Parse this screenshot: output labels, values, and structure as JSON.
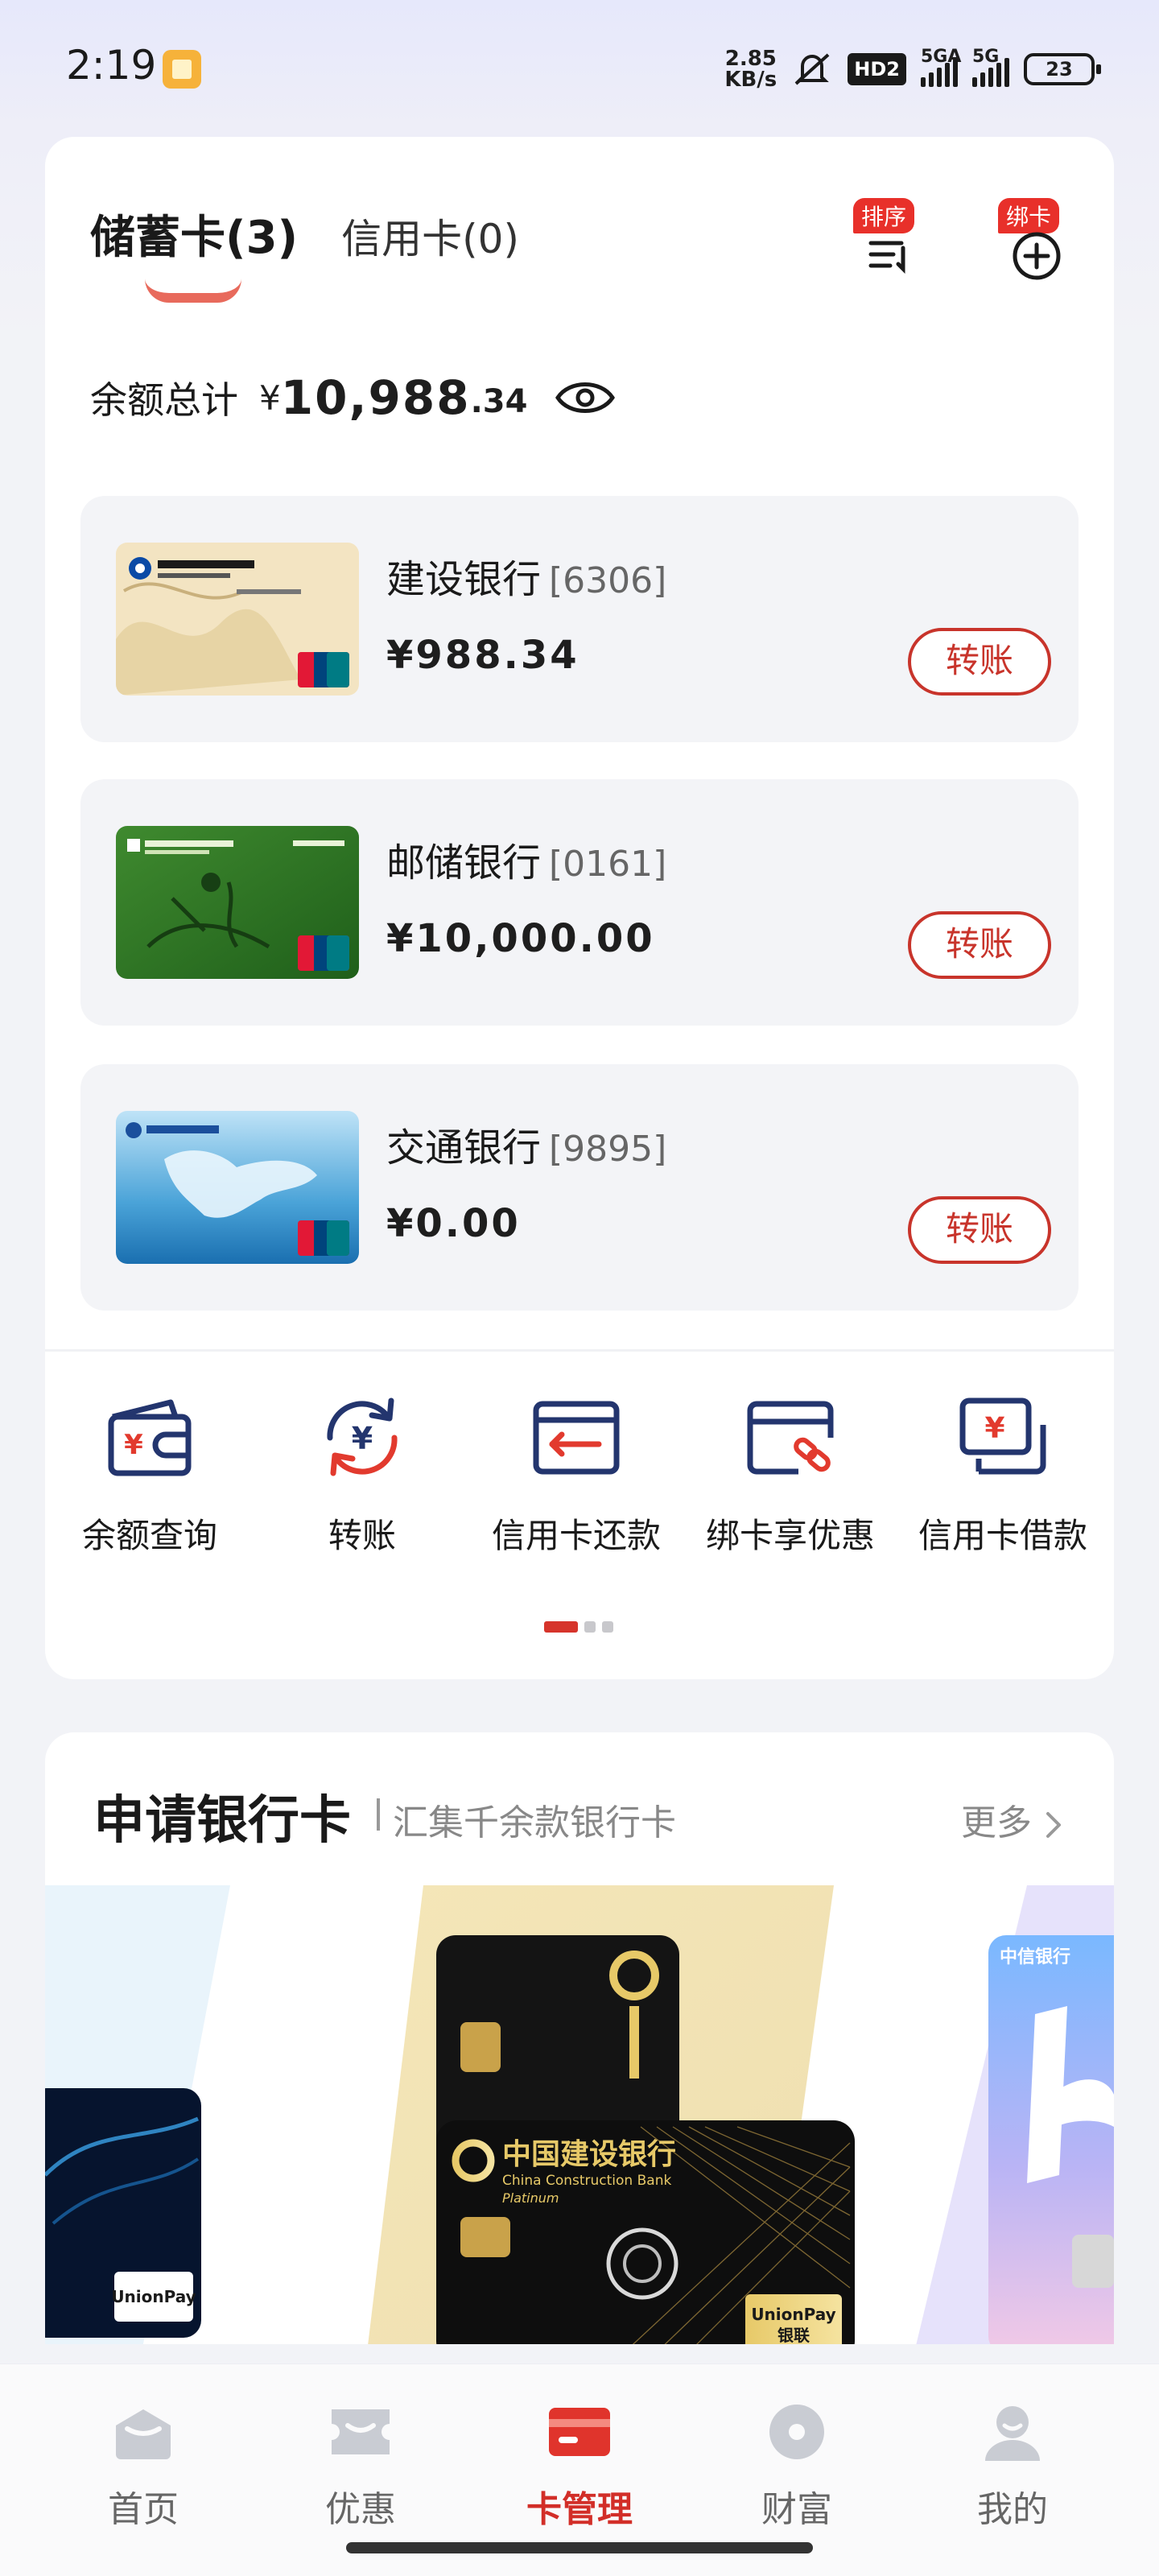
{
  "status_bar": {
    "time": "2:19",
    "net_speed_value": "2.85",
    "net_speed_unit": "KB/s",
    "hd_badge": "HD2",
    "signal1_label": "5GA",
    "signal2_label": "5G",
    "battery": "23",
    "icons": [
      "notification-app-icon",
      "mute-icon",
      "signal-icon",
      "battery-icon"
    ]
  },
  "tabs": {
    "debit": "储蓄卡(3)",
    "credit": "信用卡(0)"
  },
  "tools": {
    "sort_badge": "排序",
    "bind_badge": "绑卡"
  },
  "balance": {
    "label": "余额总计",
    "currency": "¥",
    "integer": "10,988",
    "decimal": ".34"
  },
  "cards": [
    {
      "bank": "建设银行",
      "number": "[6306]",
      "amount": "¥988.34",
      "action": "转账"
    },
    {
      "bank": "邮储银行",
      "number": "[0161]",
      "amount": "¥10,000.00",
      "action": "转账"
    },
    {
      "bank": "交通银行",
      "number": "[9895]",
      "amount": "¥0.00",
      "action": "转账"
    }
  ],
  "quick_actions": [
    {
      "label": "余额查询",
      "icon": "wallet-yuan-icon"
    },
    {
      "label": "转账",
      "icon": "transfer-yuan-icon"
    },
    {
      "label": "信用卡还款",
      "icon": "credit-card-repay-icon"
    },
    {
      "label": "绑卡享优惠",
      "icon": "card-link-icon"
    },
    {
      "label": "信用卡借款",
      "icon": "card-loan-icon"
    }
  ],
  "apply": {
    "title": "申请银行卡",
    "subtitle": "汇集千余款银行卡",
    "more": "更多",
    "promo_text": {
      "ccb_cn": "中国建设银行",
      "ccb_en": "China Construction Bank",
      "ccb_tier": "Platinum",
      "unionpay": "UnionPay",
      "unionpay_cn": "银联",
      "citic": "中信银行"
    }
  },
  "bottom_nav": [
    {
      "label": "首页",
      "icon": "home-icon"
    },
    {
      "label": "优惠",
      "icon": "coupon-icon"
    },
    {
      "label": "卡管理",
      "icon": "card-manage-icon",
      "active": true
    },
    {
      "label": "财富",
      "icon": "wealth-icon"
    },
    {
      "label": "我的",
      "icon": "profile-icon"
    }
  ],
  "colors": {
    "accent_red": "#c8342b",
    "active_nav_red": "#d22e28",
    "icon_navy": "#23356e"
  }
}
